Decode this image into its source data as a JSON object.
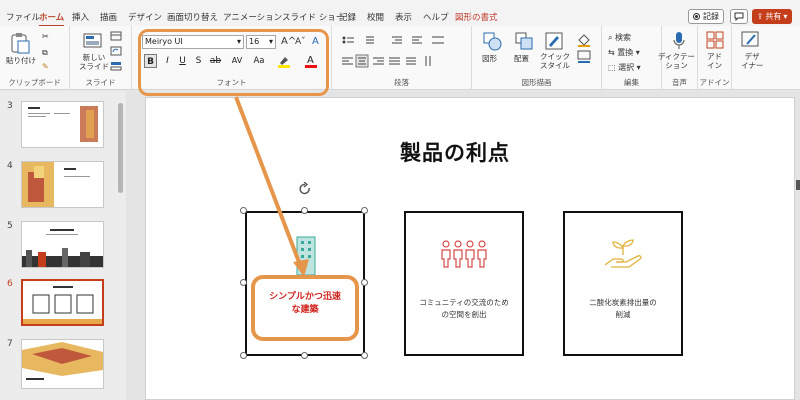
{
  "tabs": [
    "ファイル",
    "ホーム",
    "挿入",
    "描画",
    "デザイン",
    "画面切り替え",
    "アニメーション",
    "スライド ショー",
    "記録",
    "校閲",
    "表示",
    "ヘルプ",
    "図形の書式"
  ],
  "top_buttons": {
    "record": "記録",
    "comment": "",
    "share": "共有"
  },
  "ribbon": {
    "clipboard": {
      "paste": "貼り付け",
      "label": "クリップボード"
    },
    "slides": {
      "new_slide_line1": "新しい",
      "new_slide_line2": "スライド",
      "label": "スライド"
    },
    "font": {
      "name": "Meiryo UI",
      "size": "16",
      "grow": "A^",
      "shrink": "Aˇ",
      "clear": "A",
      "bold": "B",
      "italic": "I",
      "underline": "U",
      "strike": "S",
      "strike2": "ab",
      "spacing": "AV",
      "case": "Aa",
      "label": "フォント"
    },
    "paragraph": {
      "label": "段落"
    },
    "drawing": {
      "shape": "図形",
      "arrange": "配置",
      "quick_style_line1": "クイック",
      "quick_style_line2": "スタイル",
      "label": "図形描画"
    },
    "editing": {
      "find": "検索",
      "replace": "置換",
      "select": "選択",
      "label": "編集"
    },
    "voice": {
      "dictate_line1": "ディクテー",
      "dictate_line2": "ション",
      "label": "音声"
    },
    "addins": {
      "addin_line1": "アド",
      "addin_line2": "イン",
      "label": "アドイン"
    },
    "designer": {
      "line1": "デザ",
      "line2": "イナー"
    }
  },
  "thumbnails": [
    {
      "num": "3"
    },
    {
      "num": "4"
    },
    {
      "num": "5"
    },
    {
      "num": "6",
      "selected": true
    },
    {
      "num": "7"
    }
  ],
  "slide": {
    "title": "製品の利点",
    "cards": [
      {
        "text": "シンプルかつ迅速な建築"
      },
      {
        "text_line1": "コミュニティの交流のため",
        "text_line2": "の空間を創出"
      },
      {
        "text_line1": "二酸化炭素排出量の",
        "text_line2": "削減"
      }
    ],
    "callout_line1": "シンプルかつ迅速",
    "callout_line2": "な建築"
  },
  "colors": {
    "accent": "#c43e1c",
    "callout": "#e6964a",
    "callout_text": "#d0231c"
  },
  "icons": [
    "cut-icon",
    "copy-icon",
    "format-painter-icon",
    "building-icon",
    "people-icon",
    "hand-plant-icon",
    "rotate-handle-icon",
    "mic-icon",
    "search-icon"
  ]
}
